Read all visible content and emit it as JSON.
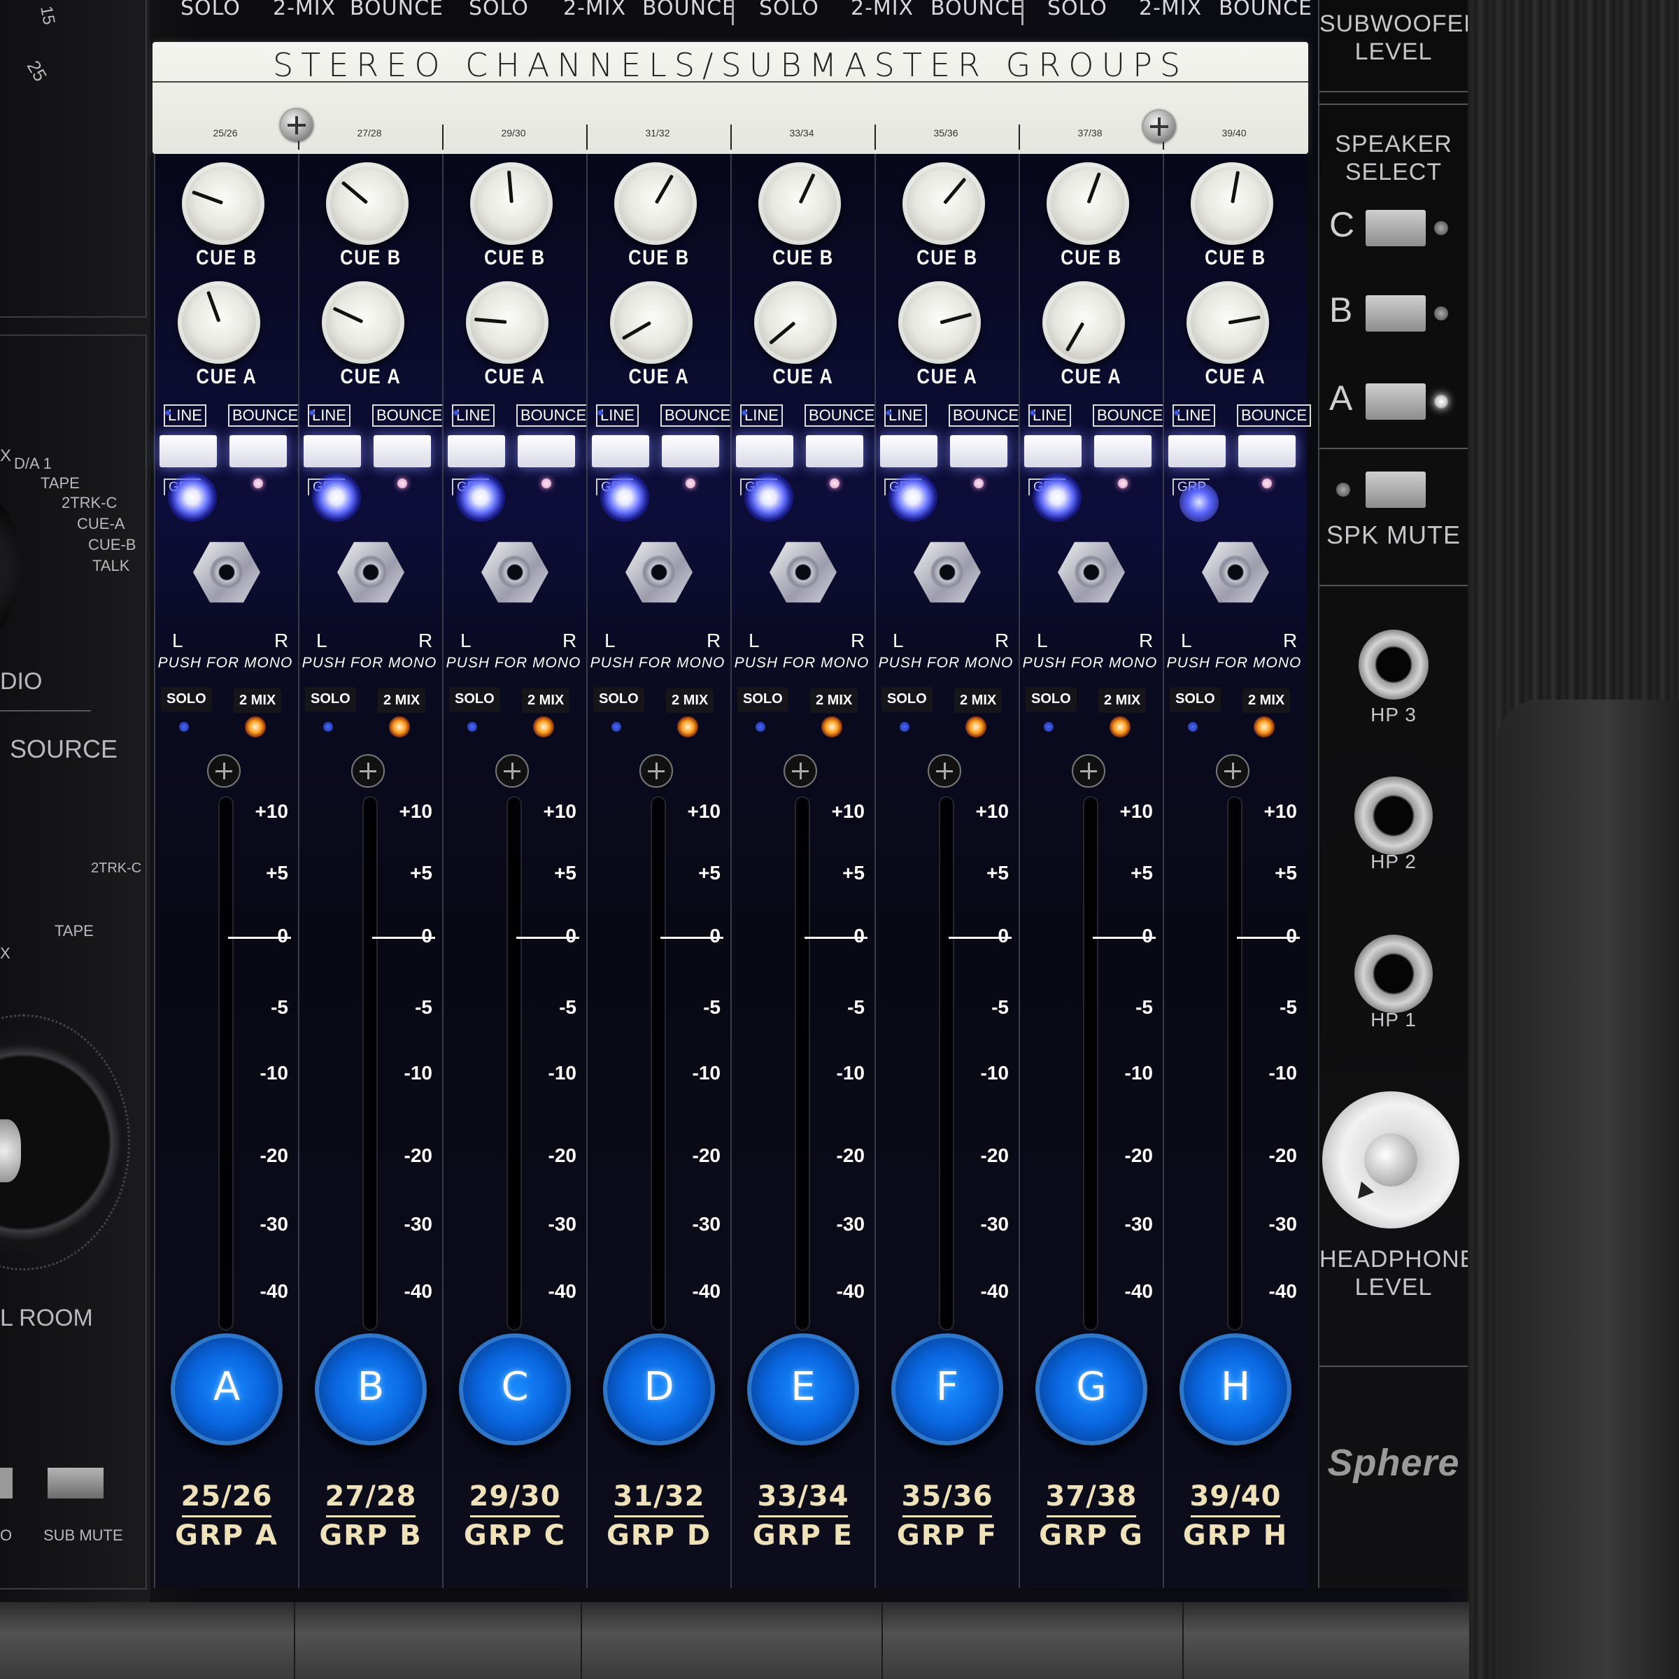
{
  "top_strip": {
    "labels": [
      "SOLO",
      "2-MIX",
      "BOUNCE",
      "SOLO",
      "2-MIX",
      "BOUNCE",
      "SOLO",
      "2-MIX",
      "BOUNCE",
      "SOLO",
      "2-MIX",
      "BOUNCE"
    ]
  },
  "scribble": {
    "title": "STEREO CHANNELS/SUBMASTER GROUPS"
  },
  "left_panel": {
    "source_items": [
      "D/A 1",
      "TAPE",
      "2TRK-C",
      "CUE-A",
      "CUE-B",
      "TALK"
    ],
    "x_mark": "X",
    "dio_label": "DIO",
    "source_label": "SOURCE",
    "trk_label": "2TRK-C",
    "tape_label": "TAPE",
    "x2_label": "X",
    "room_label": "L ROOM",
    "o_label": "O",
    "sub_mute_label": "SUB MUTE",
    "scale_15": "15",
    "scale_25": "25"
  },
  "channels": [
    {
      "id": "25/26",
      "letter": "A",
      "group": "GRP  A",
      "cue_b_angle": -70,
      "cue_a_angle": -20,
      "grp_led": "white"
    },
    {
      "id": "27/28",
      "letter": "B",
      "group": "GRP  B",
      "cue_b_angle": -50,
      "cue_a_angle": -65,
      "grp_led": "white"
    },
    {
      "id": "29/30",
      "letter": "C",
      "group": "GRP  C",
      "cue_b_angle": -5,
      "cue_a_angle": -85,
      "grp_led": "white"
    },
    {
      "id": "31/32",
      "letter": "D",
      "group": "GRP  D",
      "cue_b_angle": 30,
      "cue_a_angle": -120,
      "grp_led": "white"
    },
    {
      "id": "33/34",
      "letter": "E",
      "group": "GRP  E",
      "cue_b_angle": 25,
      "cue_a_angle": -130,
      "grp_led": "white"
    },
    {
      "id": "35/36",
      "letter": "F",
      "group": "GRP  F",
      "cue_b_angle": 40,
      "cue_a_angle": 75,
      "grp_led": "white"
    },
    {
      "id": "37/38",
      "letter": "G",
      "group": "GRP  G",
      "cue_b_angle": 20,
      "cue_a_angle": -150,
      "grp_led": "white"
    },
    {
      "id": "39/40",
      "letter": "H",
      "group": "GRP  H",
      "cue_b_angle": 10,
      "cue_a_angle": 80,
      "grp_led": "blue"
    }
  ],
  "channel_labels": {
    "cue_b": "CUE B",
    "cue_a": "CUE A",
    "line": "LINE",
    "bounce": "BOUNCE",
    "grp": "GRP",
    "left": "L",
    "right": "R",
    "push_for_mono": "PUSH FOR MONO",
    "solo": "SOLO",
    "two_mix": "2 MIX"
  },
  "fader_scale": [
    "+10",
    "+5",
    "0",
    "-5",
    "-10",
    "-20",
    "-30",
    "-40"
  ],
  "right_panel": {
    "subwoofer_level": "SUBWOOFER LEVEL",
    "speaker_select": "SPEAKER SELECT",
    "speakers": [
      "C",
      "B",
      "A"
    ],
    "active_speaker": "A",
    "spk_mute": "SPK MUTE",
    "headphones": [
      "HP 3",
      "HP 2",
      "HP 1"
    ],
    "headphone_level": "HEADPHONE LEVEL",
    "brand": "Sphere"
  },
  "colors": {
    "led_blue": "#6470ff",
    "led_orange": "#ffa020",
    "fader_cap_blue": "#0a66e0",
    "channel_text_cream": "#f0e2b8"
  }
}
